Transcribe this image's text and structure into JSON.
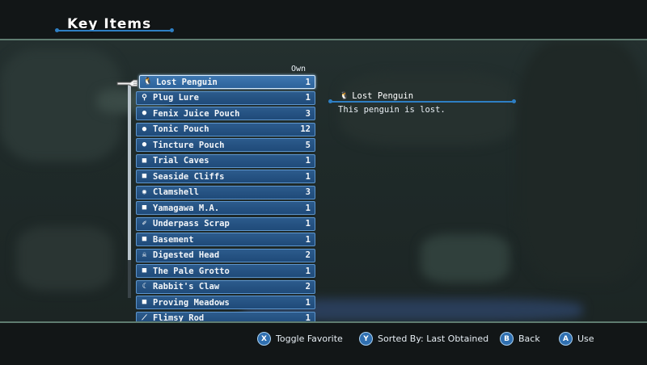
{
  "header": {
    "title": "Key Items"
  },
  "list": {
    "own_label": "Own",
    "items": [
      {
        "name": "Lost Penguin",
        "count": "1",
        "icon": "penguin-icon",
        "glyph": "🐧",
        "selected": true
      },
      {
        "name": "Plug Lure",
        "count": "1",
        "icon": "lure-icon",
        "glyph": "⚲"
      },
      {
        "name": "Fenix Juice Pouch",
        "count": "3",
        "icon": "pouch-icon",
        "glyph": "●"
      },
      {
        "name": "Tonic Pouch",
        "count": "12",
        "icon": "pouch-icon",
        "glyph": "●"
      },
      {
        "name": "Tincture Pouch",
        "count": "5",
        "icon": "pouch-icon",
        "glyph": "●"
      },
      {
        "name": "Trial Caves",
        "count": "1",
        "icon": "map-icon",
        "glyph": "■"
      },
      {
        "name": "Seaside Cliffs",
        "count": "1",
        "icon": "map-icon",
        "glyph": "■"
      },
      {
        "name": "Clamshell",
        "count": "3",
        "icon": "clamshell-icon",
        "glyph": "◉"
      },
      {
        "name": "Yamagawa M.A.",
        "count": "1",
        "icon": "map-icon",
        "glyph": "■"
      },
      {
        "name": "Underpass Scrap",
        "count": "1",
        "icon": "scrap-icon",
        "glyph": "✐"
      },
      {
        "name": "Basement",
        "count": "1",
        "icon": "map-icon",
        "glyph": "■"
      },
      {
        "name": "Digested Head",
        "count": "2",
        "icon": "skull-icon",
        "glyph": "☠"
      },
      {
        "name": "The Pale Grotto",
        "count": "1",
        "icon": "map-icon",
        "glyph": "■"
      },
      {
        "name": "Rabbit's Claw",
        "count": "2",
        "icon": "claw-icon",
        "glyph": "☾"
      },
      {
        "name": "Proving Meadows",
        "count": "1",
        "icon": "map-icon",
        "glyph": "■"
      },
      {
        "name": "Flimsy Rod",
        "count": "1",
        "icon": "rod-icon",
        "glyph": "⟋"
      }
    ]
  },
  "detail": {
    "title": "Lost Penguin",
    "icon": "penguin-icon",
    "glyph": "🐧",
    "description": "This penguin is lost."
  },
  "footer": {
    "hints": [
      {
        "button": "X",
        "label": "Toggle Favorite"
      },
      {
        "button": "Y",
        "label": "Sorted By: Last Obtained"
      },
      {
        "button": "B",
        "label": "Back"
      },
      {
        "button": "A",
        "label": "Use"
      }
    ]
  },
  "colors": {
    "accent": "#2e7fc4",
    "row_bg": "#1f4a79",
    "row_border": "#5d95cc",
    "frame_line": "#5f7c70"
  }
}
